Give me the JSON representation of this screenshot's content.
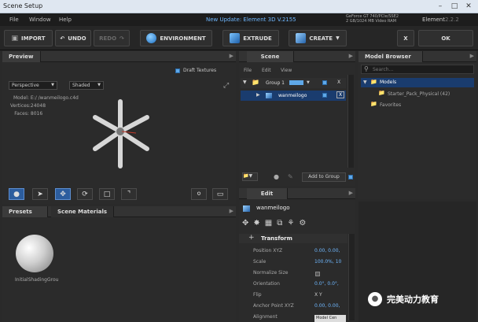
{
  "window": {
    "title": "Scene Setup"
  },
  "menu": {
    "items": [
      "File",
      "Window",
      "Help"
    ],
    "update_text": "New Update: Element 3D V.2155",
    "gpu_line1": "GeForce GT 740/PCIe/SSE2",
    "gpu_line2": "2 GB/1024 MB Video RAM",
    "app_name": "Element",
    "version": "2.2.2"
  },
  "toolbar": {
    "import": "IMPORT",
    "undo": "UNDO",
    "redo": "REDO",
    "environment": "ENVIRONMENT",
    "extrude": "EXTRUDE",
    "create": "CREATE",
    "close": "X",
    "ok": "OK"
  },
  "preview": {
    "tab": "Preview",
    "draft_textures": "Draft Textures",
    "view_mode": "Perspective",
    "shading": "Shaded",
    "model_label": "Model:",
    "model_value": "E:/            /wanmeilogo.c4d",
    "vertices_label": "Vertices:",
    "vertices_value": "24048",
    "faces_label": "Faces:",
    "faces_value": "8016"
  },
  "scene": {
    "tab": "Scene",
    "menu": [
      "File",
      "Edit",
      "View"
    ],
    "group_label": "Group 1",
    "item_label": "wanmeilogo",
    "add_to_group": "Add to Group",
    "x_label": "X"
  },
  "browser": {
    "tab": "Model Browser",
    "search_placeholder": "Search...",
    "models": "Models",
    "starter_pack": "Starter_Pack_Physical (42)",
    "favorites": "Favorites"
  },
  "presets": {
    "tab1": "Presets",
    "tab2": "Scene Materials",
    "material_name": "InitialShadingGrou"
  },
  "edit": {
    "tab": "Edit",
    "object_name": "wanmeilogo",
    "section": "Transform",
    "rows": [
      {
        "label": "Position XYZ",
        "value": "0.00,  0.00,"
      },
      {
        "label": "Scale",
        "value": "100.0%,  10"
      },
      {
        "label": "Normalize Size",
        "value": ""
      },
      {
        "label": "Orientation",
        "value": "0.0°,  0.0°,"
      },
      {
        "label": "Flip",
        "value": "X    Y"
      },
      {
        "label": "Anchor Point XYZ",
        "value": "0.00,  0.00,"
      },
      {
        "label": "Alignment",
        "value": "Model Cen"
      }
    ]
  },
  "watermark": {
    "text": "完美动力教育"
  },
  "colors": {
    "accent": "#2c5d9e",
    "highlight": "#5fa8e8",
    "update": "#6fb8ff"
  }
}
